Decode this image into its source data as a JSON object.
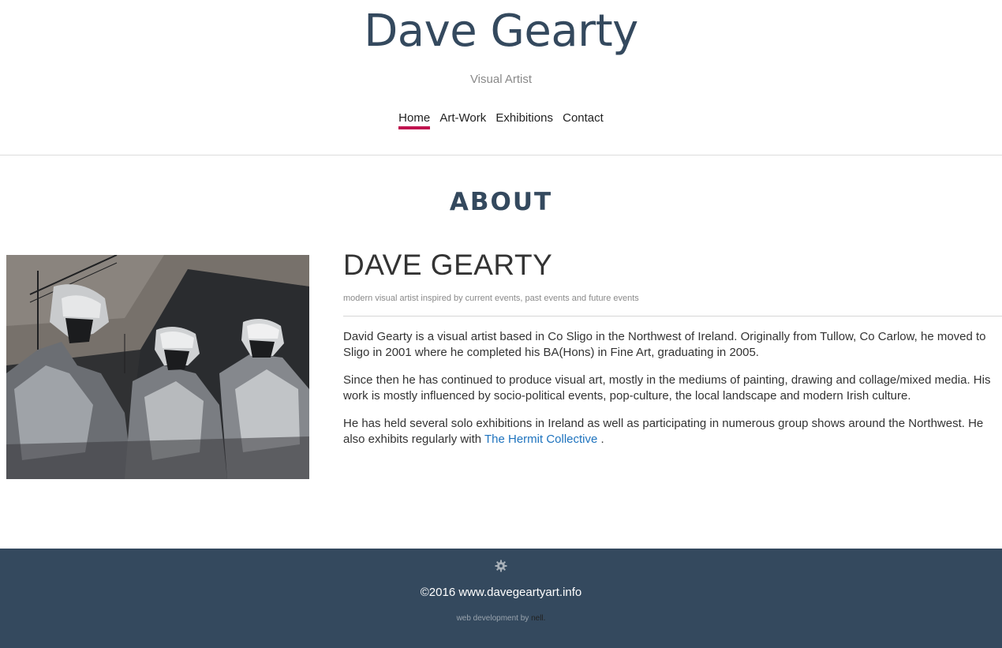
{
  "site": {
    "title": "Dave Gearty",
    "tagline": "Visual Artist"
  },
  "nav": {
    "items": [
      {
        "label": "Home",
        "active": true
      },
      {
        "label": "Art-Work",
        "active": false
      },
      {
        "label": "Exhibitions",
        "active": false
      },
      {
        "label": "Contact",
        "active": false
      }
    ]
  },
  "about": {
    "section_title": "ABOUT",
    "name": "DAVE GEARTY",
    "subtitle": "modern visual artist inspired by current events, past events and future events",
    "paragraph1": "David Gearty is a visual artist based in Co Sligo in the Northwest of Ireland. Originally from Tullow, Co Carlow, he moved to Sligo in 2001 where he completed his BA(Hons) in Fine Art, graduating in 2005.",
    "paragraph2": "Since then he has continued to produce visual art, mostly in the mediums of painting, drawing and collage/mixed media. His work is mostly influenced by socio-political events, pop-culture, the local landscape and modern Irish culture.",
    "paragraph3_prefix": "He has held several solo exhibitions in Ireland as well as participating in numerous group shows around the Northwest. He also exhibits regularly with ",
    "paragraph3_link": "The Hermit Collective",
    "paragraph3_suffix": " ."
  },
  "footer": {
    "icon": "gear-icon",
    "copyright": "©2016 www.davegeartyart.info",
    "dev_prefix": "web development by ",
    "dev_link": "nell."
  },
  "colors": {
    "brand": "#34495e",
    "accent": "#c0134f",
    "link": "#1e73be"
  }
}
